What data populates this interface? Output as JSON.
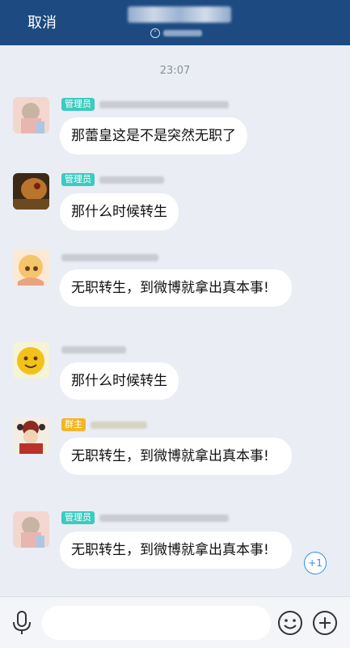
{
  "header": {
    "cancel_label": "取消",
    "chevron_glyph": "˅"
  },
  "chat": {
    "timestamp": "23:07",
    "messages": [
      {
        "badge": "管理员",
        "badge_type": "admin",
        "text": "那蕾皇这是不是突然无职了"
      },
      {
        "badge": "管理员",
        "badge_type": "admin",
        "text": "那什么时候转生"
      },
      {
        "badge": "",
        "badge_type": "none",
        "text": "无职转生，到微博就拿出真本事!"
      },
      {
        "badge": "",
        "badge_type": "none",
        "text": "那什么时候转生"
      },
      {
        "badge": "群主",
        "badge_type": "owner",
        "text": "无职转生，到微博就拿出真本事!"
      },
      {
        "badge": "管理员",
        "badge_type": "admin",
        "text": "无职转生，到微博就拿出真本事!"
      }
    ],
    "plus_one_label": "+1"
  },
  "input_bar": {
    "placeholder": ""
  },
  "colors": {
    "header_bg": "#1d4a80",
    "chat_bg": "#eaedf4",
    "admin_badge": "#3bcbc0",
    "owner_badge": "#f2b626",
    "accent": "#2e8ef0"
  }
}
